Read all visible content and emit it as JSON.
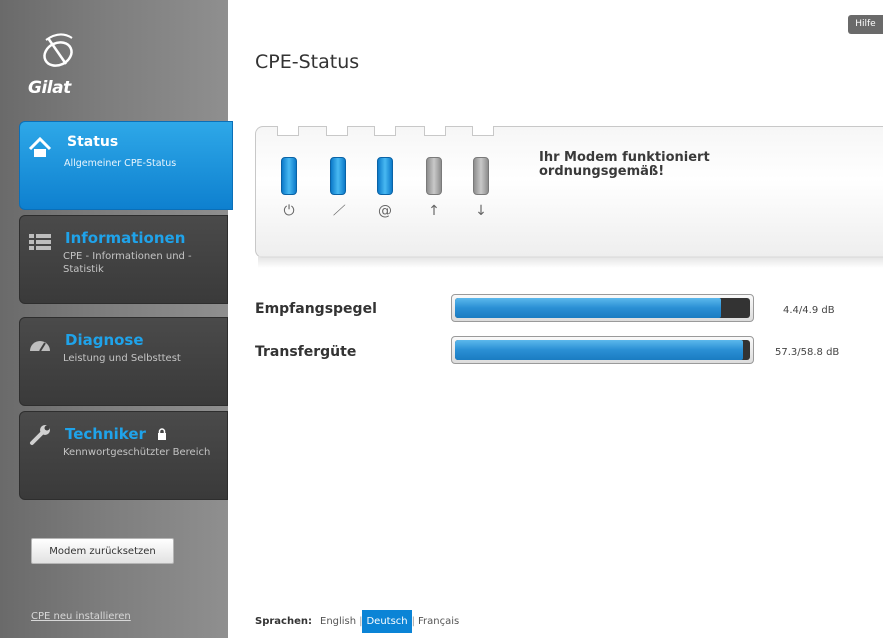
{
  "app": {
    "logo_text": "Gilat",
    "help_label": "Hilfe"
  },
  "colors": {
    "accent": "#0b84d6",
    "sidebar": "#7a7a7a",
    "nav_inactive_title": "#1fa3ea"
  },
  "sidebar": {
    "items": [
      {
        "title": "Status",
        "subtitle": "Allgemeiner CPE-Status",
        "icon": "home-icon",
        "active": true
      },
      {
        "title": "Informationen",
        "subtitle": "CPE - Informationen und -Statistik",
        "icon": "list-icon",
        "active": false
      },
      {
        "title": "Diagnose",
        "subtitle": "Leistung und Selbsttest",
        "icon": "gauge-icon",
        "active": false
      },
      {
        "title": "Techniker",
        "subtitle": "Kennwortgeschützter Bereich",
        "icon": "wrench-icon",
        "locked": true,
        "active": false
      }
    ],
    "reset_button": "Modem zurücksetzen",
    "reinstall_link": "CPE neu installieren"
  },
  "main": {
    "title": "CPE-Status",
    "status_message": "Ihr Modem funktioniert ordnungsgemäß!",
    "leds": [
      {
        "icon": "power-icon",
        "glyph": "⏻",
        "state": "on"
      },
      {
        "icon": "satellite-icon",
        "glyph": "⟋",
        "state": "on"
      },
      {
        "icon": "at-icon",
        "glyph": "@",
        "state": "on"
      },
      {
        "icon": "upload-icon",
        "glyph": "↑",
        "state": "off"
      },
      {
        "icon": "download-icon",
        "glyph": "↓",
        "state": "off"
      }
    ],
    "metrics": [
      {
        "label": "Empfangspegel",
        "value": "4.4/4.9 dB",
        "fill_fraction": 0.9
      },
      {
        "label": "Transfergüte",
        "value": "57.3/58.8 dB",
        "fill_fraction": 0.975
      }
    ]
  },
  "footer": {
    "languages_label": "Sprachen:",
    "languages": [
      {
        "label": "English",
        "active": false
      },
      {
        "label": "Deutsch",
        "active": true
      },
      {
        "label": "Français",
        "active": false
      }
    ]
  }
}
